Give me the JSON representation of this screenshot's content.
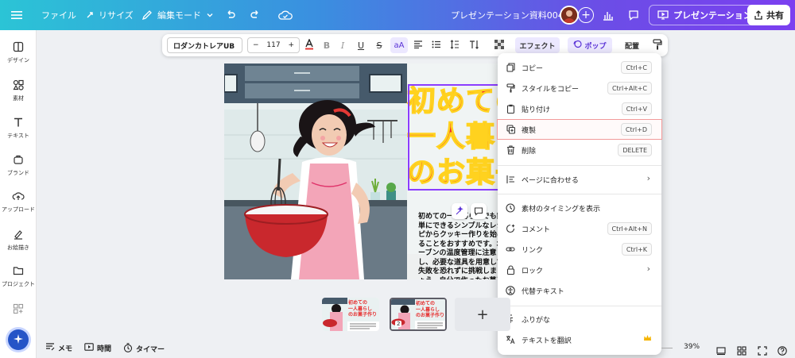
{
  "topbar": {
    "file_label": "ファイル",
    "resize_label": "リサイズ",
    "edit_mode_label": "編集モード",
    "document_title": "プレゼンテーション資料004",
    "present_label": "プレゼンテーション",
    "share_label": "共有"
  },
  "sidebar": {
    "items": [
      {
        "label": "デザイン",
        "icon": "layout-icon"
      },
      {
        "label": "素材",
        "icon": "elements-icon"
      },
      {
        "label": "テキスト",
        "icon": "text-icon"
      },
      {
        "label": "ブランド",
        "icon": "brand-icon"
      },
      {
        "label": "アップロード",
        "icon": "upload-icon"
      },
      {
        "label": "お絵描き",
        "icon": "draw-icon"
      },
      {
        "label": "プロジェクト",
        "icon": "folder-icon"
      }
    ]
  },
  "text_toolbar": {
    "font_name": "ロダンカトレアUB",
    "font_size": "117",
    "minus": "−",
    "plus": "+",
    "effects_label": "エフェクト",
    "pop_label": "ポップ",
    "position_label": "配置"
  },
  "canvas": {
    "headline_lines": [
      "初めての",
      "一人暮らし",
      "のお菓子作り"
    ],
    "body_text": "初めての一人暮らしでも簡単にできるシンプルなレシピからクッキー作りを始めることをおすすめです。オーブンの温度管理に注意し、必要な道具を用意して失敗を恐れずに挑戦しましょう。自分で作ったお菓子を味わうのも楽しみのひとつです。"
  },
  "context_menu": {
    "items": [
      {
        "label": "コピー",
        "shortcut": "Ctrl+C",
        "icon": "copy-icon"
      },
      {
        "label": "スタイルをコピー",
        "shortcut": "Ctrl+Alt+C",
        "icon": "paint-roller-icon"
      },
      {
        "label": "貼り付け",
        "shortcut": "Ctrl+V",
        "icon": "clipboard-icon"
      },
      {
        "label": "複製",
        "shortcut": "Ctrl+D",
        "icon": "duplicate-icon"
      },
      {
        "label": "削除",
        "shortcut": "DELETE",
        "icon": "trash-icon"
      },
      {
        "label": "ページに合わせる",
        "icon": "fit-page-icon"
      },
      {
        "label": "素材のタイミングを表示",
        "icon": "clock-icon"
      },
      {
        "label": "コメント",
        "shortcut": "Ctrl+Alt+N",
        "icon": "comment-plus-icon"
      },
      {
        "label": "リンク",
        "shortcut": "Ctrl+K",
        "icon": "link-icon"
      },
      {
        "label": "ロック",
        "icon": "lock-icon"
      },
      {
        "label": "代替テキスト",
        "icon": "accessibility-icon"
      },
      {
        "label": "ふりがな",
        "icon": "furigana-icon"
      },
      {
        "label": "テキストを翻訳",
        "icon": "translate-icon"
      }
    ]
  },
  "pages": {
    "thumb_headline": [
      "初めての",
      "一人暮らし",
      "のお菓子作り"
    ],
    "page2_number": "2",
    "add_page": "+"
  },
  "bottom": {
    "notes_label": "メモ",
    "timing_label": "時間",
    "timer_label": "タイマー",
    "zoom": "39%"
  }
}
